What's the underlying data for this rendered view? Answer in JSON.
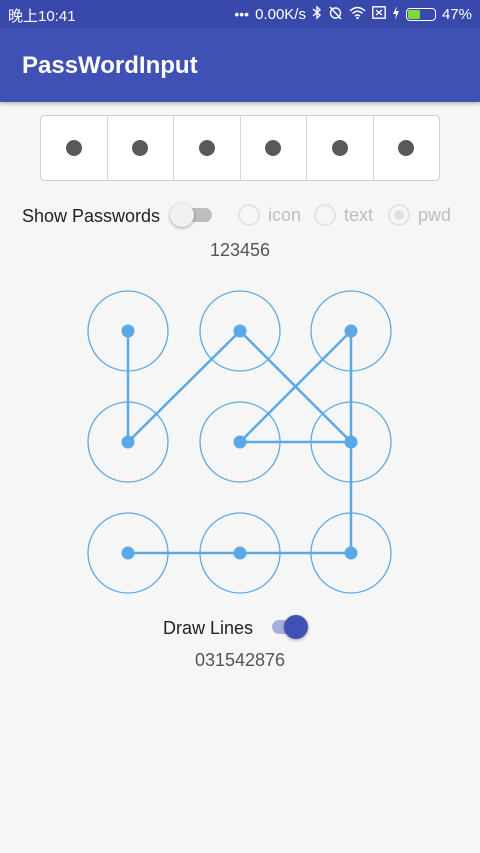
{
  "status_bar": {
    "time": "晚上10:41",
    "speed": "0.00K/s",
    "battery": "47%",
    "icons": [
      "dots-icon",
      "bluetooth-icon",
      "alarm-off-icon",
      "wifi-icon",
      "sim-card-icon",
      "charging-icon",
      "battery-icon"
    ]
  },
  "app_bar": {
    "title": "PassWordInput"
  },
  "password_box": {
    "cell_count": 6,
    "filled_count": 6
  },
  "options": {
    "show_passwords_label": "Show Passwords",
    "show_passwords_on": false,
    "radios": [
      {
        "label": "icon",
        "checked": false
      },
      {
        "label": "text",
        "checked": false
      },
      {
        "label": "pwd",
        "checked": true
      }
    ]
  },
  "password_value": "123456",
  "lock_pattern": {
    "color": "#5aa9e6",
    "grid_size": 3,
    "sequence_text": "031542876"
  },
  "draw_lines": {
    "label": "Draw Lines",
    "on": true
  },
  "colors": {
    "primary": "#3f51b5",
    "status_bar": "#3949ab",
    "accent": "#3f51b5",
    "pattern": "#5aa9e6"
  }
}
